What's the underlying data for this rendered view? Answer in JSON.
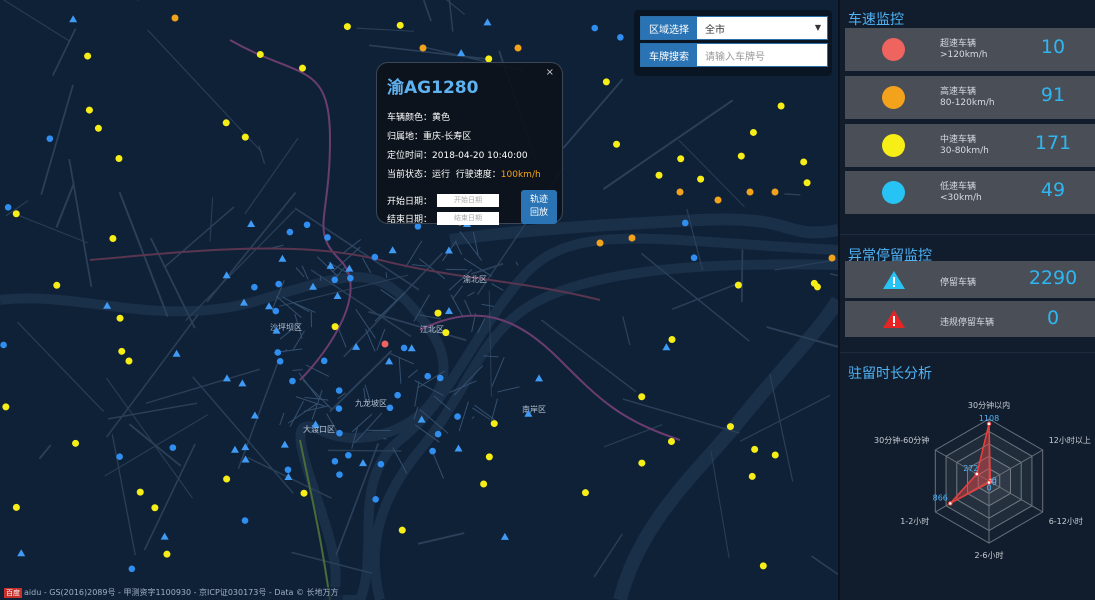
{
  "map": {
    "place_labels": [
      "九龙坡区",
      "大渡口区",
      "南岸区",
      "渝北区",
      "江北区",
      "沙坪坝区"
    ],
    "copyright_logo": "百度",
    "copyright": "aidu - GS(2016)2089号 - 甲测资字1100930 - 京ICP证030173号 - Data © 长地万方"
  },
  "controls": {
    "region_label": "区域选择",
    "region_value": "全市",
    "plate_label": "车牌搜索",
    "plate_placeholder": "请输入车牌号"
  },
  "popup": {
    "plate": "渝AG1280",
    "color_label": "车辆颜色：",
    "color_value": "黄色",
    "home_label": "归属地：",
    "home_value": "重庆-长寿区",
    "time_label": "定位时间：",
    "time_value": "2018-04-20 10:40:00",
    "status_label": "当前状态：",
    "status_value": "运行",
    "speed_label": "行驶速度：",
    "speed_value": "100km/h",
    "start_label": "开始日期：",
    "start_placeholder": "开始日期",
    "end_label": "结束日期：",
    "end_placeholder": "结束日期",
    "replay_line1": "轨迹",
    "replay_line2": "回放",
    "close": "×"
  },
  "speed_monitor": {
    "title": "车速监控",
    "items": [
      {
        "name": "超速车辆",
        "range": ">120km/h",
        "value": "10",
        "color": "#f0645f"
      },
      {
        "name": "高速车辆",
        "range": "80-120km/h",
        "value": "91",
        "color": "#f3a21b"
      },
      {
        "name": "中速车辆",
        "range": "30-80km/h",
        "value": "171",
        "color": "#f6ee16"
      },
      {
        "name": "低速车辆",
        "range": "<30km/h",
        "value": "49",
        "color": "#26c3f4"
      }
    ]
  },
  "stop_monitor": {
    "title": "异常停留监控",
    "items": [
      {
        "name": "停留车辆",
        "value": "2290",
        "color": "#26c3f4"
      },
      {
        "name": "违规停留车辆",
        "value": "0",
        "color": "#e62424"
      }
    ]
  },
  "duration": {
    "title": "驻留时长分析",
    "chart_data": {
      "type": "radar",
      "indicators": [
        "30分钟以内",
        "12小时以上",
        "6-12小时",
        "2-6小时",
        "1-2小时",
        "30分钟-60分钟"
      ],
      "values": [
        1108,
        0,
        0,
        0,
        866,
        272
      ],
      "labels": [
        "1108",
        "0",
        "0",
        "0",
        "866",
        "272"
      ],
      "max": 1200,
      "series_color": "#e8413d"
    }
  }
}
